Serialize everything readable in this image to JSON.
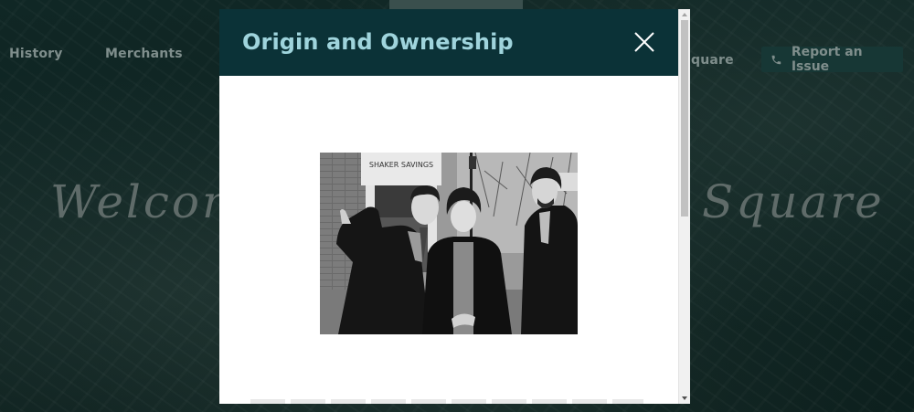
{
  "background": {
    "nav": {
      "history": "History",
      "merchants": "Merchants",
      "square": "quare"
    },
    "report_button": {
      "label": "Report an Issue",
      "icon": "phone-icon"
    },
    "hero": {
      "left": "Welcom",
      "right": "Square"
    }
  },
  "modal": {
    "title": "Origin and Ownership",
    "close_icon": "close-icon",
    "image": {
      "sign_text": "SHAKER SAVINGS"
    }
  },
  "colors": {
    "header_bg": "#0b3237",
    "title_color": "#9fd4dc",
    "page_bg": "#0f2422",
    "report_btn_bg": "#173735"
  }
}
